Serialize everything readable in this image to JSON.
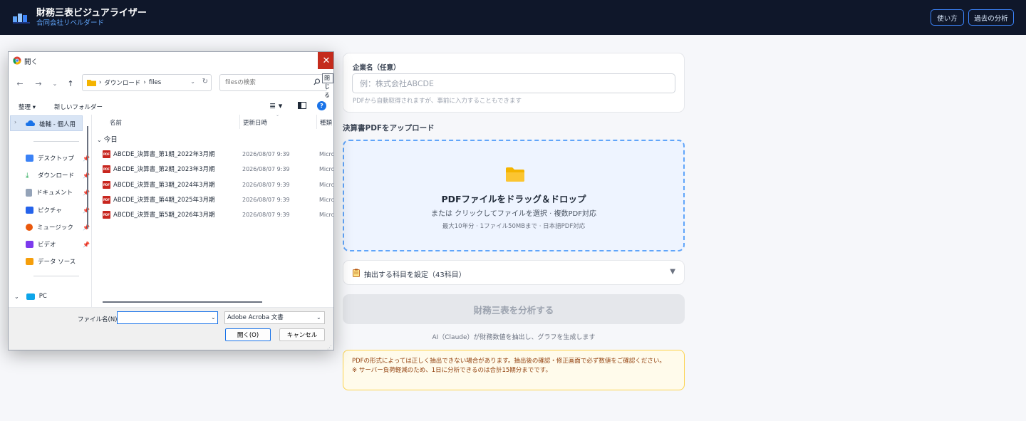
{
  "header": {
    "title": "財務三表ビジュアライザー",
    "subtitle": "合同会社リベルダード",
    "how_to_label": "使い方",
    "history_label": "過去の分析"
  },
  "form": {
    "company_label": "企業名（任意）",
    "company_placeholder": "例：株式会社ABCDE",
    "company_help": "PDFから自動取得されますが、事前に入力することもできます",
    "upload_heading": "決算書PDFをアップロード",
    "dropzone": {
      "title": "PDFファイルをドラッグ＆ドロップ",
      "subtitle": "または クリックしてファイルを選択 · 複数PDF対応",
      "note": "最大10年分 · 1ファイル50MBまで · 日本語PDF対応"
    },
    "fields_label": "抽出する科目を設定（43科目）",
    "fields_chevron": "▼",
    "analyze_label": "財務三表を分析する",
    "analyze_caption": "AI（Claude）が財務数値を抽出し、グラフを生成します",
    "warning_line1": "PDFの形式によっては正しく抽出できない場合があります。抽出後の確認・修正画面で必ず数値をご確認ください。",
    "warning_line2": "※ サーバー負荷軽減のため、1日に分析できるのは合計15期分までです。"
  },
  "dialog": {
    "title": "開く",
    "close_glyph": "✕",
    "close_tooltip": "閉じる",
    "breadcrumb": [
      "ダウンロード",
      "files"
    ],
    "search_placeholder": "filesの検索",
    "organize_label": "整理 ▾",
    "new_folder_label": "新しいフォルダー",
    "sidebar": {
      "cloud": "雄輔 - 個人用",
      "items": [
        {
          "label": "デスクトップ",
          "color": "#3b82f6"
        },
        {
          "label": "ダウンロード",
          "color": "#16a34a"
        },
        {
          "label": "ドキュメント",
          "color": "#94a3b8"
        },
        {
          "label": "ピクチャ",
          "color": "#2563eb"
        },
        {
          "label": "ミュージック",
          "color": "#ea580c"
        },
        {
          "label": "ビデオ",
          "color": "#7c3aed"
        },
        {
          "label": "データ ソース",
          "color": "#f59e0b"
        }
      ],
      "pc": "PC"
    },
    "columns": {
      "name": "名前",
      "date": "更新日時",
      "type": "種類"
    },
    "group": "今日",
    "files": [
      {
        "name": "ABCDE_決算書_第1期_2022年3月期",
        "date": "2026/08/07 9:39",
        "type": "Micro"
      },
      {
        "name": "ABCDE_決算書_第2期_2023年3月期",
        "date": "2026/08/07 9:39",
        "type": "Micro"
      },
      {
        "name": "ABCDE_決算書_第3期_2024年3月期",
        "date": "2026/08/07 9:39",
        "type": "Micro"
      },
      {
        "name": "ABCDE_決算書_第4期_2025年3月期",
        "date": "2026/08/07 9:39",
        "type": "Micro"
      },
      {
        "name": "ABCDE_決算書_第5期_2026年3月期",
        "date": "2026/08/07 9:39",
        "type": "Micro"
      }
    ],
    "filename_label": "ファイル名(N):",
    "filetype_value": "Adobe Acroba 文書",
    "open_label": "開く(O)",
    "cancel_label": "キャンセル"
  }
}
